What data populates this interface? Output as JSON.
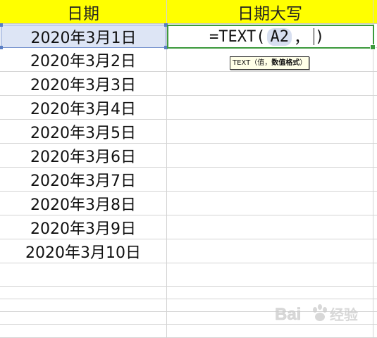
{
  "header": {
    "col_a": "日期",
    "col_b": "日期大写"
  },
  "rows": [
    "2020年3月1日",
    "2020年3月2日",
    "2020年3月3日",
    "2020年3月4日",
    "2020年3月5日",
    "2020年3月6日",
    "2020年3月7日",
    "2020年3月8日",
    "2020年3月9日",
    "2020年3月10日"
  ],
  "formula": {
    "prefix": "=TEXT(",
    "ref": "A2",
    "sep": "，",
    "close": ")"
  },
  "tooltip": {
    "func": "TEXT",
    "open": "（",
    "arg1": "值，",
    "arg2": "数值格式",
    "close": "）"
  },
  "watermark": "Bai 经验"
}
